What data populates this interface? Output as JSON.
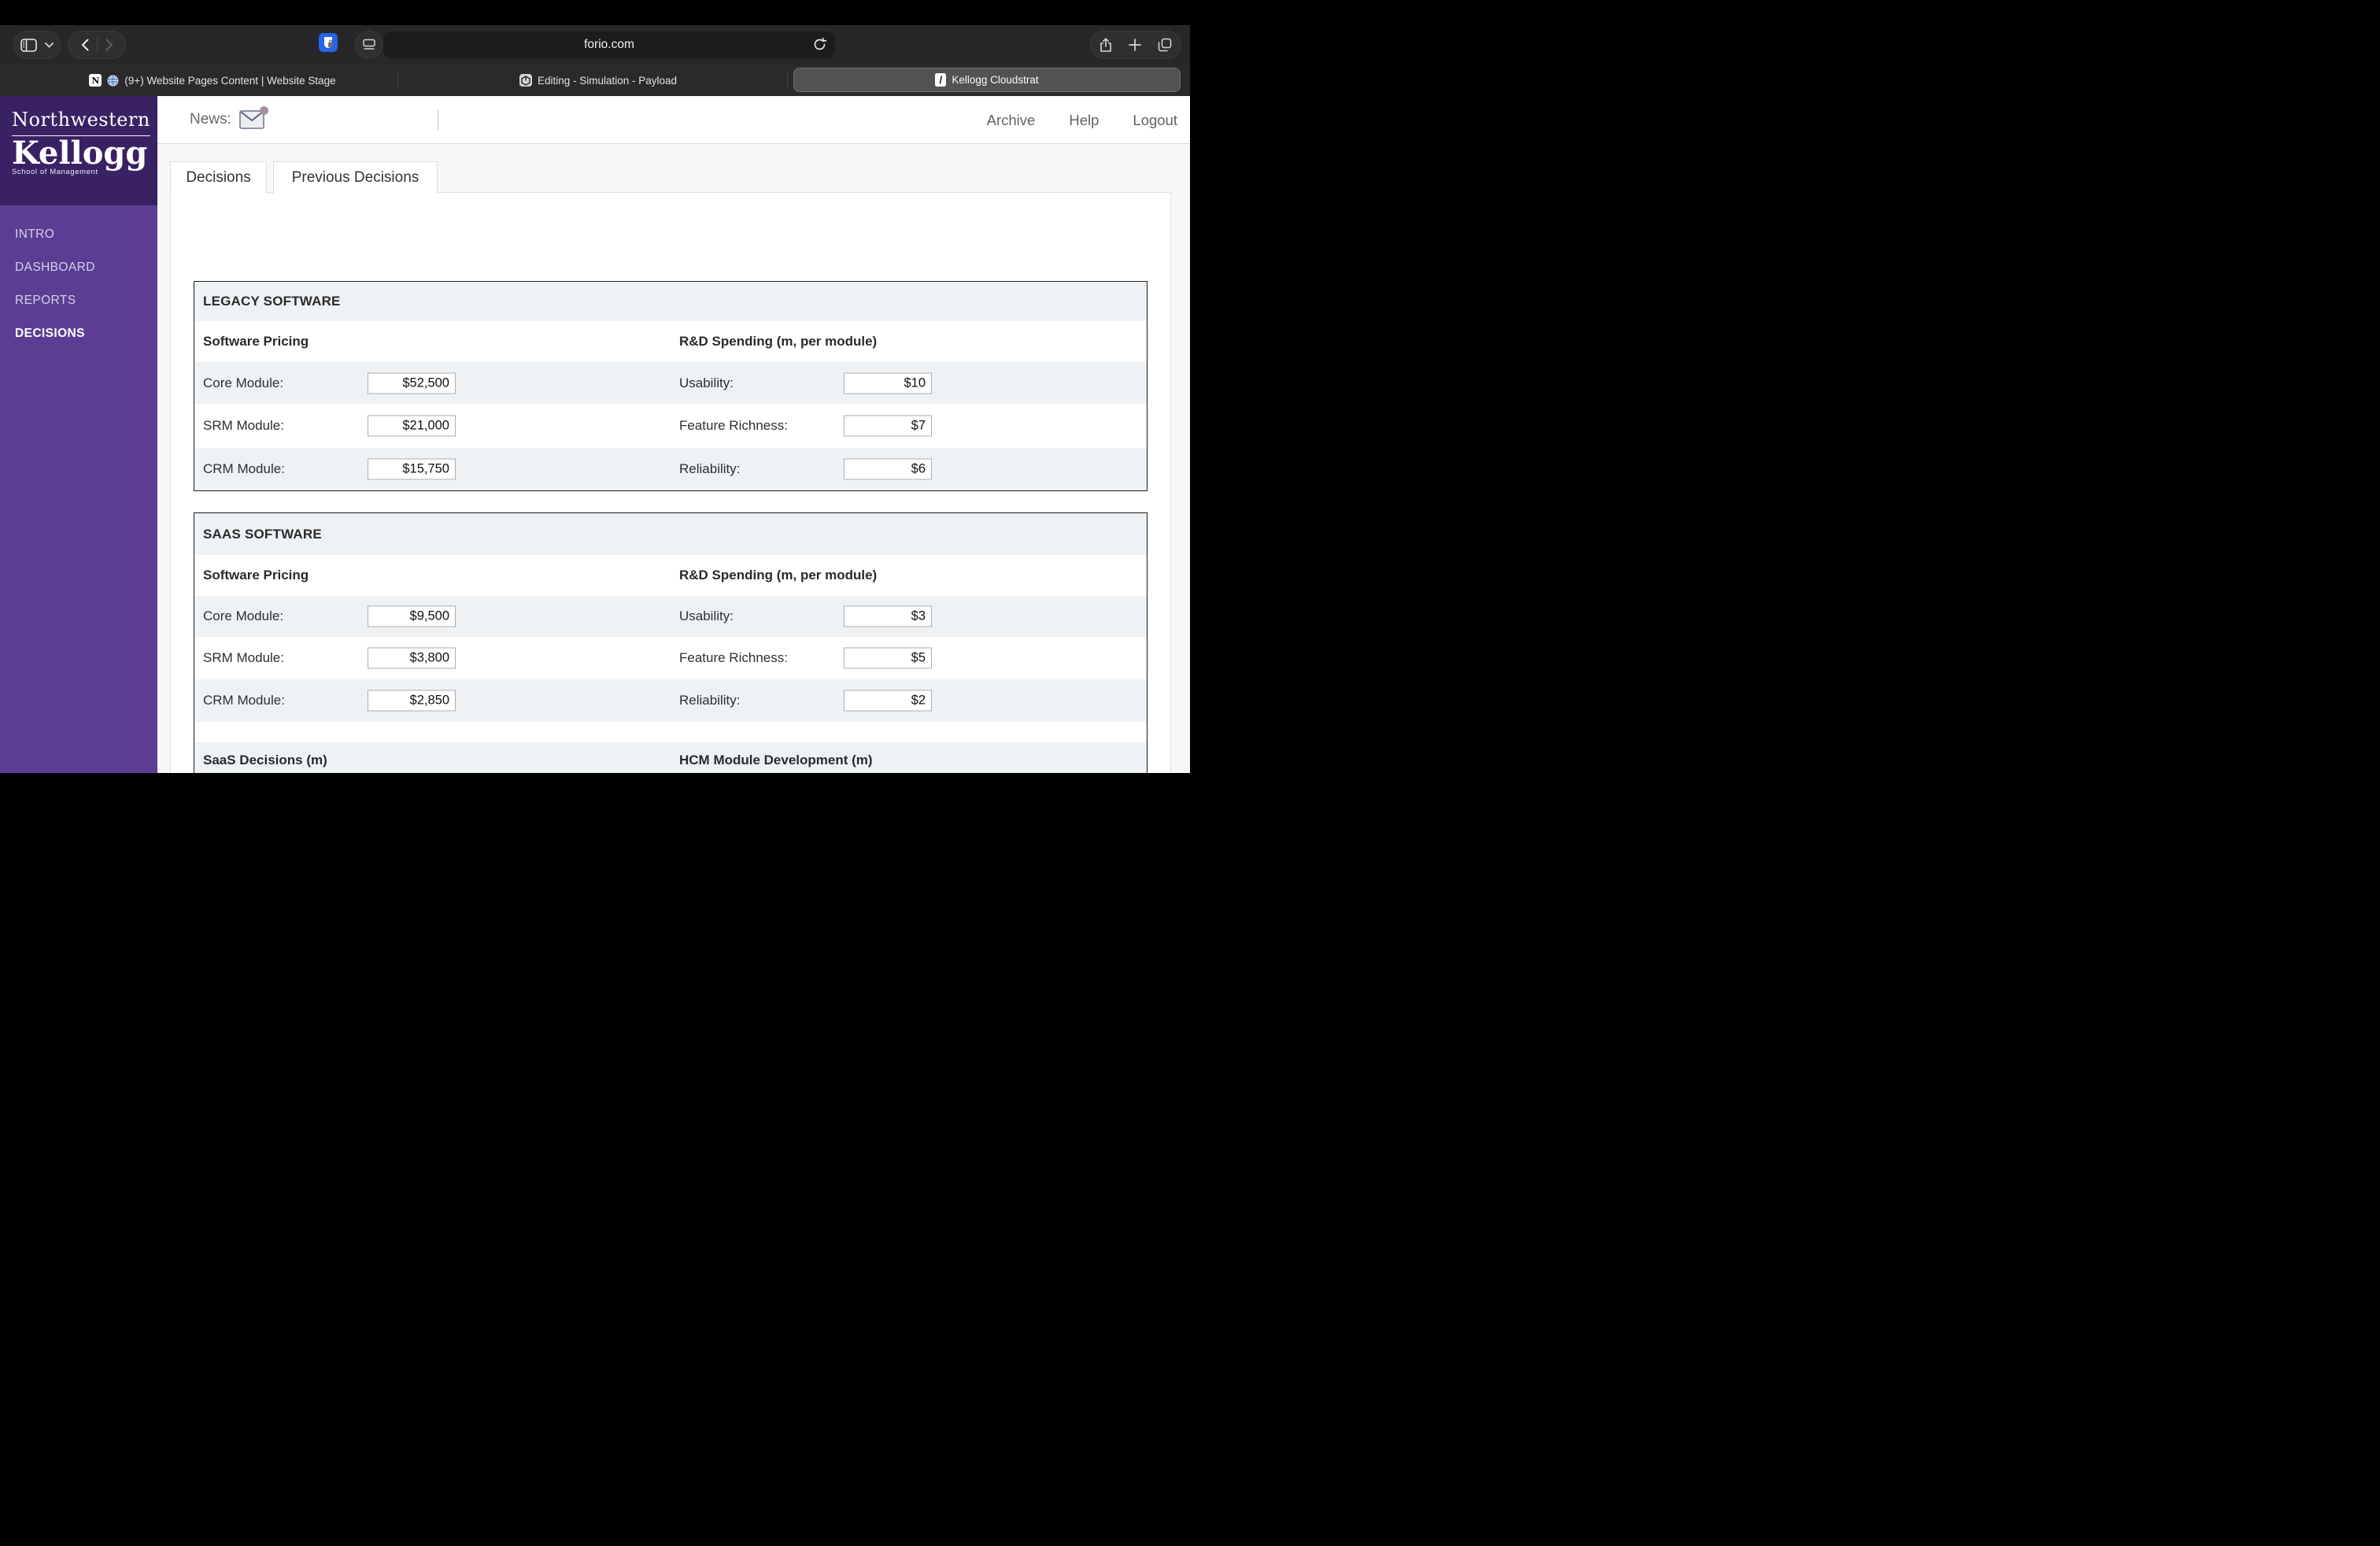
{
  "browser": {
    "url": "forio.com",
    "tabs": [
      {
        "title": "(9+) Website Pages Content | Website Stage"
      },
      {
        "title": "Editing - Simulation - Payload"
      },
      {
        "title": "Kellogg Cloudstrat"
      }
    ],
    "tab3_favicon_glyph": "/",
    "tab1_favicon_glyph": "N"
  },
  "logo": {
    "line1": "Northwestern",
    "line2": "Kellogg",
    "line3": "School of Management"
  },
  "sidebar": {
    "items": [
      {
        "label": "INTRO"
      },
      {
        "label": "DASHBOARD"
      },
      {
        "label": "REPORTS"
      },
      {
        "label": "DECISIONS"
      }
    ]
  },
  "header": {
    "news_label": "News:",
    "archive": "Archive",
    "help": "Help",
    "logout": "Logout"
  },
  "app_tabs": {
    "decisions": "Decisions",
    "previous": "Previous Decisions"
  },
  "legacy": {
    "title": "LEGACY SOFTWARE",
    "left_header": "Software Pricing",
    "right_header": "R&D Spending (m, per module)",
    "rows": [
      {
        "left_label": "Core Module:",
        "left_value": "$52,500",
        "right_label": "Usability:",
        "right_value": "$10"
      },
      {
        "left_label": "SRM Module:",
        "left_value": "$21,000",
        "right_label": "Feature Richness:",
        "right_value": "$7"
      },
      {
        "left_label": "CRM Module:",
        "left_value": "$15,750",
        "right_label": "Reliability:",
        "right_value": "$6"
      }
    ]
  },
  "saas": {
    "title": "SAAS SOFTWARE",
    "left_header": "Software Pricing",
    "right_header": "R&D Spending (m, per module)",
    "rows": [
      {
        "left_label": "Core Module:",
        "left_value": "$9,500",
        "right_label": "Usability:",
        "right_value": "$3"
      },
      {
        "left_label": "SRM Module:",
        "left_value": "$3,800",
        "right_label": "Feature Richness:",
        "right_value": "$5"
      },
      {
        "left_label": "CRM Module:",
        "left_value": "$2,850",
        "right_label": "Reliability:",
        "right_value": "$2"
      }
    ],
    "footer_left": "SaaS Decisions (m)",
    "footer_right": "HCM Module Development (m)"
  },
  "colors": {
    "sidebar_purple": "#5b3e94",
    "logo_purple": "#3a2164",
    "row_highlight": "#eef2f5",
    "news_badge": "#a4909e",
    "extension_blue": "#2465eb"
  }
}
